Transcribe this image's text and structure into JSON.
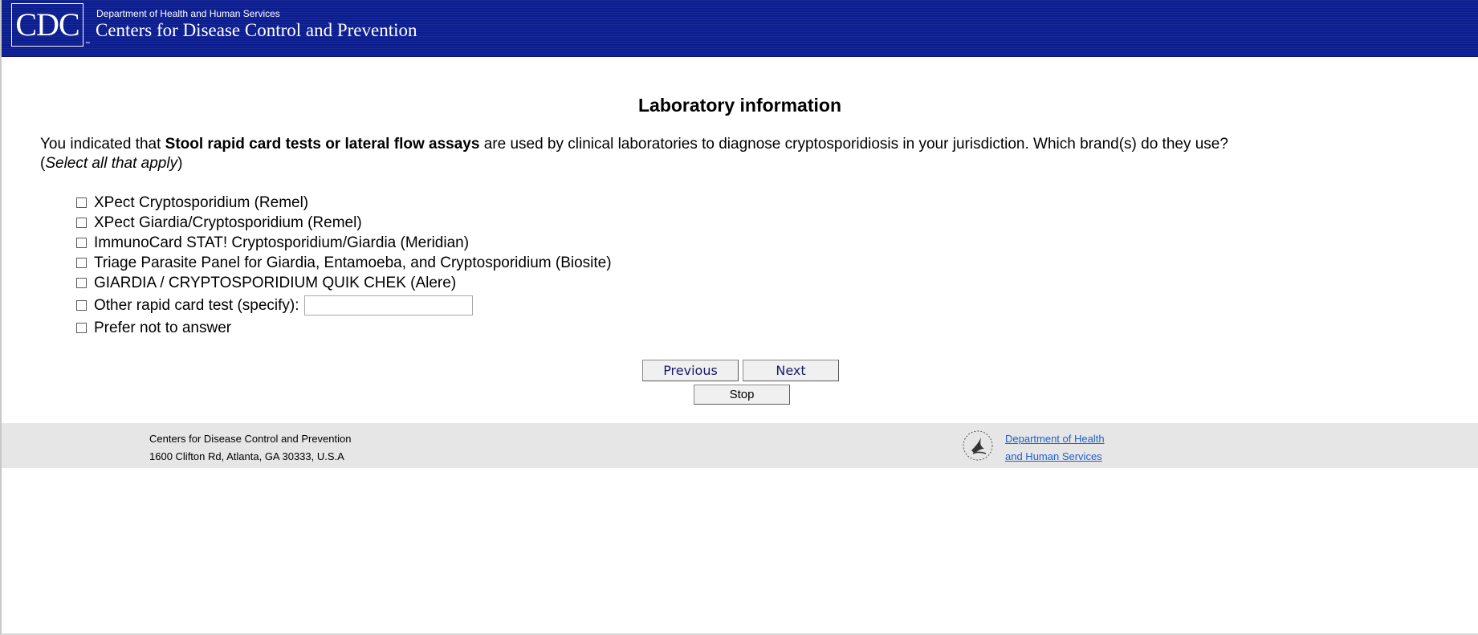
{
  "header": {
    "logo_text": "CDC",
    "department": "Department of Health and Human Services",
    "agency": "Centers for Disease Control and Prevention"
  },
  "main": {
    "title": "Laboratory information",
    "question_prefix": "You indicated that ",
    "question_bold": "Stool rapid card tests or lateral flow assays",
    "question_suffix": " are used by clinical laboratories to diagnose cryptosporidiosis in your jurisdiction. Which brand(s) do they use?",
    "instruction_open": "(",
    "instruction": "Select all that apply",
    "instruction_close": ")",
    "options": [
      {
        "label": "XPect Cryptosporidium (Remel)"
      },
      {
        "label": "XPect Giardia/Cryptosporidium (Remel)"
      },
      {
        "label": "ImmunoCard STAT! Cryptosporidium/Giardia (Meridian)"
      },
      {
        "label": "Triage Parasite Panel for Giardia, Entamoeba, and Cryptosporidium (Biosite)"
      },
      {
        "label": "GIARDIA / CRYPTOSPORIDIUM QUIK CHEK (Alere)"
      },
      {
        "label": "Other rapid card test (specify):",
        "input_value": ""
      },
      {
        "label": "Prefer not to answer"
      }
    ]
  },
  "nav": {
    "previous": "Previous",
    "next": "Next",
    "stop": "Stop"
  },
  "footer": {
    "org_name": "Centers for Disease Control and Prevention",
    "address": "1600 Clifton Rd, Atlanta, GA 30333, U.S.A",
    "hhs_link_line1": "Department of Health",
    "hhs_link_line2": "and Human Services",
    "link_color": "#1e5fd6"
  },
  "colors": {
    "header_bg": "#0b1d8f",
    "footer_bg": "#e6e6e6"
  }
}
